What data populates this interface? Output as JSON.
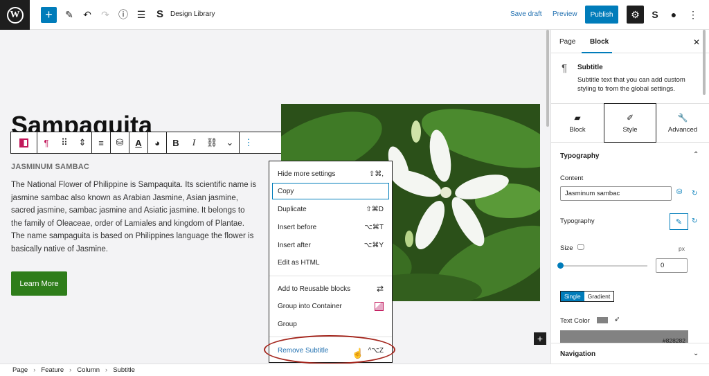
{
  "topbar": {
    "title": "Design Library",
    "save_draft": "Save draft",
    "preview": "Preview",
    "publish": "Publish"
  },
  "canvas": {
    "heading": "Sampaquita",
    "subtitle": "JASMINUM SAMBAC",
    "paragraph_lines": [
      "The National Flower of Philippine is Sampaquita. Its scientific name is",
      "jasmine sambac also known as Arabian Jasmine, Asian jasmine,",
      "sacred jasmine, sambac jasmine and Asiatic jasmine. It belongs to",
      "the family of Oleaceae, order of Lamiales and kingdom of Plantae.",
      "The name sampaguita is based on Philippines language the flower is",
      "basically native of Jasmine."
    ],
    "button": "Learn More"
  },
  "menu": {
    "items": [
      {
        "label": "Hide more settings",
        "shortcut": "⇧⌘,"
      },
      {
        "label": "Copy",
        "shortcut": ""
      },
      {
        "label": "Duplicate",
        "shortcut": "⇧⌘D"
      },
      {
        "label": "Insert before",
        "shortcut": "⌥⌘T"
      },
      {
        "label": "Insert after",
        "shortcut": "⌥⌘Y"
      },
      {
        "label": "Edit as HTML",
        "shortcut": ""
      },
      {
        "label": "Add to Reusable blocks",
        "shortcut": ""
      },
      {
        "label": "Group into Container",
        "shortcut": ""
      },
      {
        "label": "Group",
        "shortcut": ""
      },
      {
        "label": "Remove Subtitle",
        "shortcut": "^⌥Z"
      }
    ]
  },
  "breadcrumb": [
    "Page",
    "Feature",
    "Column",
    "Subtitle"
  ],
  "sidebar": {
    "tabs": [
      "Page",
      "Block"
    ],
    "block_title": "Subtitle",
    "block_desc": "Subtitle text that you can add custom styling to from the global settings.",
    "style_tabs": [
      "Block",
      "Style",
      "Advanced"
    ],
    "typography_header": "Typography",
    "content_label": "Content",
    "content_value": "Jasminum sambac",
    "typography_label": "Typography",
    "size_label": "Size",
    "size_unit": "px",
    "size_value": "0",
    "seg_single": "Single",
    "seg_gradient": "Gradient",
    "text_color_label": "Text Color",
    "color_hex": "#828282",
    "navigation_header": "Navigation"
  },
  "colors": {
    "accent": "#007cba",
    "button_green": "#2e7d1a",
    "highlight_ellipse": "#a4261d"
  }
}
